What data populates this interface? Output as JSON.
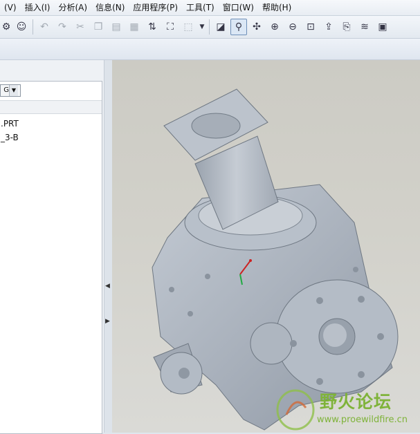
{
  "menu": {
    "items": [
      "(V)",
      "插入(I)",
      "分析(A)",
      "信息(N)",
      "应用程序(P)",
      "工具(T)",
      "窗口(W)",
      "帮助(H)"
    ]
  },
  "toolbar": {
    "icons": [
      "mapkey-icon",
      "undo-icon",
      "redo-icon",
      "cut-icon",
      "copy-icon",
      "paste-icon",
      "paste-special-icon",
      "regenerate-icon",
      "find-icon",
      "select-box-icon",
      "dropdown-arrow-icon",
      "named-view-icon",
      "spin-center-icon",
      "orient-icon",
      "zoom-in-icon",
      "zoom-out-icon",
      "refit-icon",
      "reorient-icon",
      "annotation-icon",
      "layers-icon",
      "repaint-icon"
    ]
  },
  "model_tree": {
    "dropdown_value": "G",
    "items": [
      ".PRT",
      "_3-B"
    ]
  },
  "watermark": {
    "title": "野火论坛",
    "url": "www.proewildfire.cn"
  },
  "colors": {
    "model_body": "#a9b1bc",
    "viewport_bg": "#cfcec7",
    "watermark_green": "#7fb33a"
  }
}
